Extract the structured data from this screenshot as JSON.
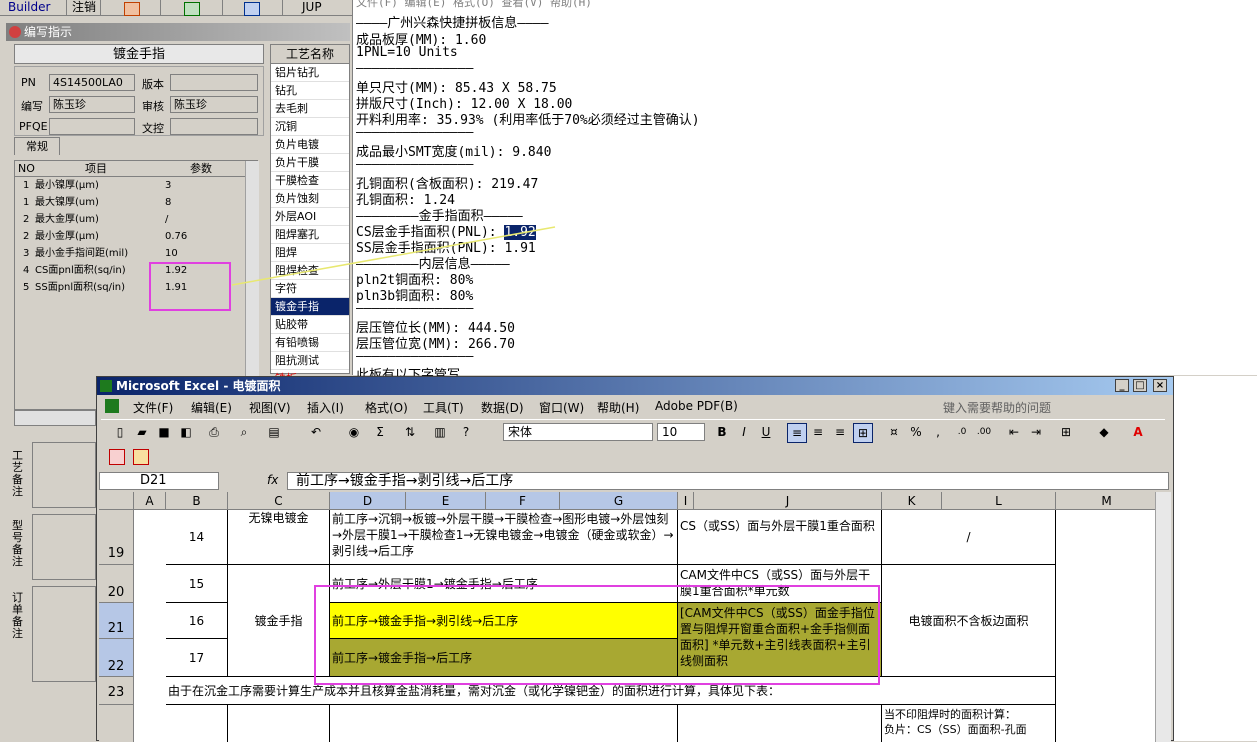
{
  "topbar": {
    "builder": "Builder",
    "cancel": "注销",
    "jup": "JUP"
  },
  "editor": {
    "title": "编写指示",
    "section": "镀金手指",
    "fields": {
      "pn_label": "PN",
      "pn_value": "4S14500LA0",
      "version_label": "版本",
      "version_value": "",
      "writer_label": "编写",
      "writer_value": "陈玉珍",
      "reviewer_label": "审核",
      "reviewer_value": "陈玉珍",
      "pfqe_label": "PFQE",
      "pfqe_value": "",
      "control_label": "文控",
      "control_value": ""
    },
    "tab": "常规",
    "table_headers": [
      "NO",
      "项目",
      "参数"
    ],
    "rows": [
      {
        "no": "1",
        "item": "最小镍厚(μm)",
        "value": "3"
      },
      {
        "no": "1",
        "item": "最大镍厚(um)",
        "value": "8"
      },
      {
        "no": "2",
        "item": "最大金厚(um)",
        "value": "/"
      },
      {
        "no": "2",
        "item": "最小金厚(μm)",
        "value": "0.76"
      },
      {
        "no": "3",
        "item": "最小金手指间距(mil)",
        "value": "10"
      },
      {
        "no": "4",
        "item": "CS面pnl面积(sq/in)",
        "value": "1.92"
      },
      {
        "no": "5",
        "item": "SS面pnl面积(sq/in)",
        "value": "1.91"
      }
    ],
    "side_labels": [
      "工艺备注",
      "型号备注",
      "订单备注"
    ]
  },
  "process": {
    "header": "工艺名称",
    "items": [
      "铝片钻孔",
      "钻孔",
      "去毛刺",
      "沉铜",
      "负片电镀",
      "负片干膜",
      "干膜检查",
      "负片蚀刻",
      "外层AOI",
      "阻焊塞孔",
      "阻焊",
      "阻焊检查",
      "字符",
      "镀金手指",
      "贴胶带",
      "有铅喷锡",
      "阻抗测试",
      "铣板"
    ],
    "selected": "镀金手指"
  },
  "info": {
    "menu": "文件(F)  编辑(E)  格式(O)  查看(V)  帮助(H)",
    "lines": [
      "————广州兴森快捷拼板信息————",
      "成品板厚(MM): 1.60",
      "1PNL=10 Units",
      "———————————————",
      "单只尺寸(MM): 85.43 X 58.75",
      "拼版尺寸(Inch): 12.00 X 18.00",
      "开料利用率: 35.93% (利用率低于70%必须经过主管确认)",
      "———————————————",
      "成品最小SMT宽度(mil): 9.840",
      "———————————————",
      "孔铜面积(含板面积): 219.47",
      "孔铜面积: 1.24",
      "————————金手指面积—————",
      "CS层金手指面积(PNL): ",
      "SS层金手指面积(PNL): 1.91",
      "————————内层信息—————",
      "pln2t铜面积: 80%",
      "pln3b铜面积: 80%",
      "———————————————",
      "层压管位长(MM): 444.50",
      "层压管位宽(MM): 266.70",
      "———————————————",
      "此板有以下字管写"
    ],
    "highlight": "1.92"
  },
  "excel": {
    "title": "Microsoft Excel - 电镀面积",
    "menu": [
      "文件(F)",
      "编辑(E)",
      "视图(V)",
      "插入(I)",
      "格式(O)",
      "工具(T)",
      "数据(D)",
      "窗口(W)",
      "帮助(H)",
      "Adobe PDF(B)"
    ],
    "help_placeholder": "键入需要帮助的问题",
    "font_name": "宋体",
    "font_size": "10",
    "cell_ref": "D21",
    "fx": "fx",
    "formula": "前工序→镀金手指→剥引线→后工序",
    "columns": [
      "A",
      "B",
      "C",
      "D",
      "E",
      "F",
      "G",
      "I",
      "J",
      "K",
      "L",
      "M"
    ],
    "rows": [
      {
        "num": "19",
        "b": "14",
        "c": "无镍电镀金",
        "d": "前工序→沉铜→板镀→外层干膜→干膜检查→图形电镀→外层蚀刻→外层干膜1→干膜检查1→无镍电镀金→电镀金（硬金或软金）→剥引线→后工序",
        "j": "CS（或SS）面与外层干膜1重合面积",
        "k": "/"
      },
      {
        "num": "20",
        "b": "15",
        "c": "",
        "d": "前工序→外层干膜1→镀金手指→后工序",
        "j": "CAM文件中CS（或SS）面与外层干膜1重合面积*单元数",
        "k": ""
      },
      {
        "num": "21",
        "b": "16",
        "c": "镀金手指",
        "d": "前工序→镀金手指→剥引线→后工序",
        "j": "[CAM文件中CS（或SS）面金手指位置与阻焊开窗重合面积+金手指侧面面积] *单元数+主引线表面积+主引线侧面积",
        "k": "电镀面积不含板边面积"
      },
      {
        "num": "22",
        "b": "17",
        "c": "",
        "d": "前工序→镀金手指→后工序",
        "j": "",
        "k": ""
      },
      {
        "num": "23",
        "note": "由于在沉金工序需要计算生产成本并且核算金盐消耗量，需对沉金（或化学镍钯金）的面积进行计算，具体见下表："
      }
    ],
    "bottom_k": "当不印阻焊时的面积计算：",
    "bottom_k2": "负片：CS（SS）面面积-孔面"
  },
  "colors": {
    "highlight_box": "#e040e0",
    "yellow": "#ffff00",
    "olive": "#a8a832",
    "title_blue": "#0a246a"
  }
}
